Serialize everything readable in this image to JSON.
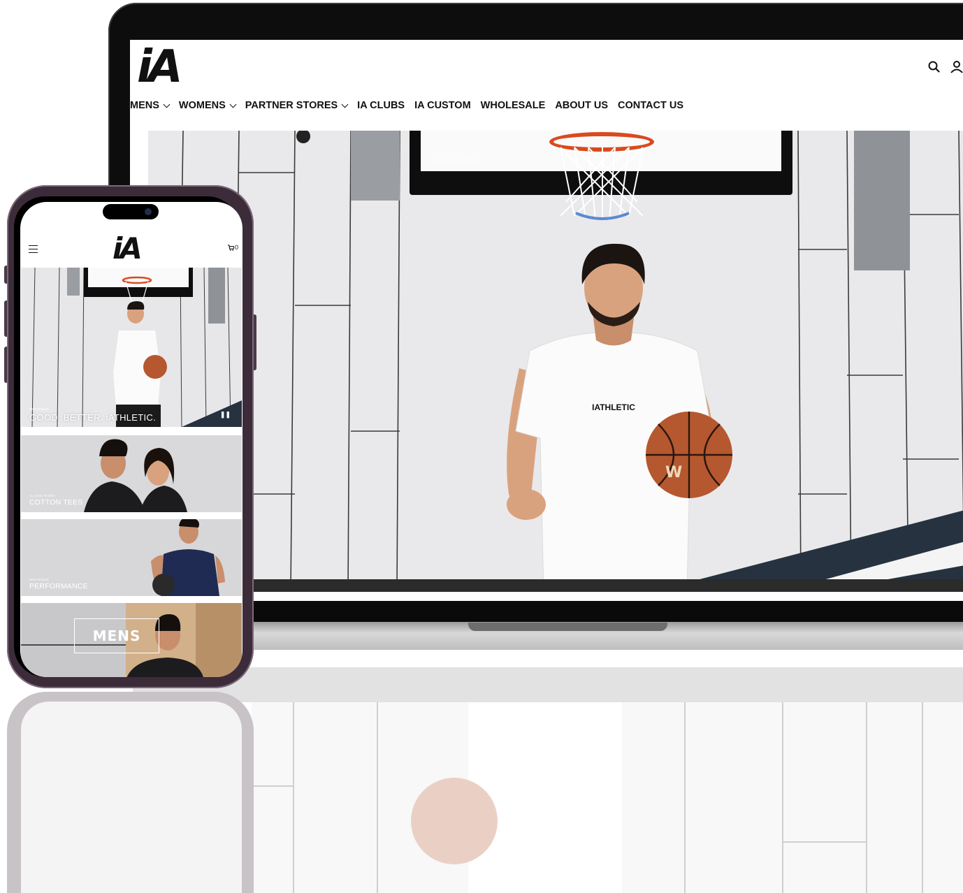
{
  "desktop": {
    "logo": "iA",
    "nav": [
      {
        "label": "MENS",
        "has_dropdown": true
      },
      {
        "label": "WOMENS",
        "has_dropdown": true
      },
      {
        "label": "PARTNER STORES",
        "has_dropdown": true
      },
      {
        "label": "IA CLUBS",
        "has_dropdown": false
      },
      {
        "label": "IA CUSTOM",
        "has_dropdown": false
      },
      {
        "label": "WHOLESALE",
        "has_dropdown": false
      },
      {
        "label": "ABOUT US",
        "has_dropdown": false
      },
      {
        "label": "CONTACT US",
        "has_dropdown": false
      }
    ],
    "header_icons": [
      "search-icon",
      "account-icon"
    ],
    "hero": {
      "backboard_text": "RINGLEADER",
      "shirt_text": "IATHLETIC",
      "ball_text": "W"
    }
  },
  "mobile": {
    "logo": "iA",
    "cart_count": "0",
    "hero": {
      "eyebrow": "NEW RANGE",
      "title": "GOOD. BETTER. iATHLETIC.",
      "pause_icon": "pause-icon"
    },
    "cards": [
      {
        "eyebrow": "CLASSIC RANGE",
        "title": "COTTON TEES"
      },
      {
        "eyebrow": "NEW RANGE",
        "title": "PERFORMANCE"
      },
      {
        "eyebrow": "",
        "title": "MENS"
      }
    ]
  },
  "colors": {
    "brand": "#111111",
    "rim": "#d94a1e",
    "phone_frame": "#3c2c3a",
    "wall": "#e8e8ea"
  }
}
